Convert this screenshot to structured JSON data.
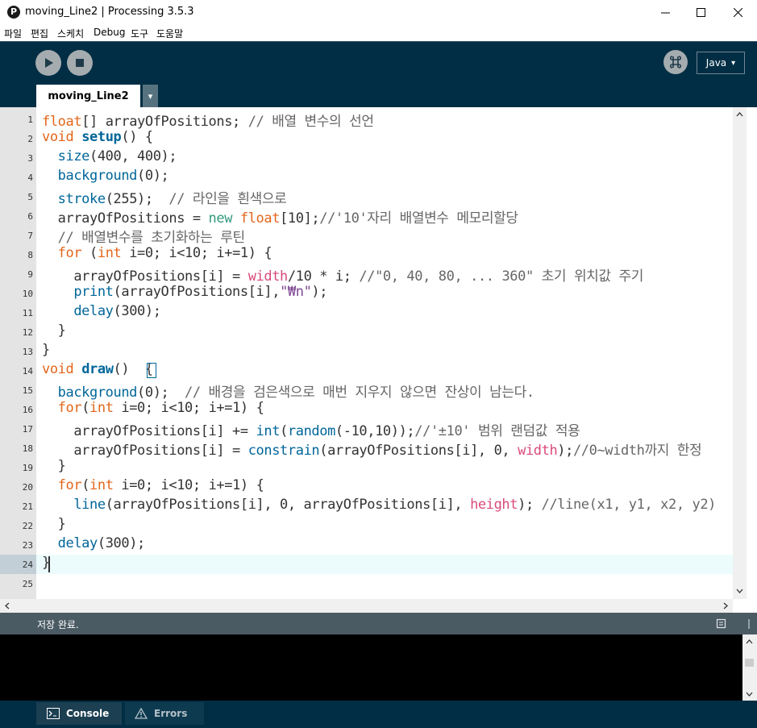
{
  "window": {
    "app_icon_text": "P",
    "title": "moving_Line2 | Processing 3.5.3",
    "minimize_icon": "minimize-icon",
    "maximize_icon": "maximize-icon",
    "close_icon": "close-icon"
  },
  "menubar": {
    "items": [
      "파일",
      "편집",
      "스케치",
      "Debug",
      "도구",
      "도움말"
    ]
  },
  "toolbar": {
    "run_icon": "play-icon",
    "stop_icon": "stop-icon",
    "debugger_icon": "debugger-icon",
    "mode": "Java",
    "mode_arrow": "▾"
  },
  "tab": {
    "label": "moving_Line2",
    "menu_arrow": "▾"
  },
  "editor": {
    "current_line": 24,
    "lines": [
      {
        "n": "1"
      },
      {
        "n": "2"
      },
      {
        "n": "3"
      },
      {
        "n": "4"
      },
      {
        "n": "5"
      },
      {
        "n": "6"
      },
      {
        "n": "7"
      },
      {
        "n": "8"
      },
      {
        "n": "9"
      },
      {
        "n": "10"
      },
      {
        "n": "11"
      },
      {
        "n": "12"
      },
      {
        "n": "13"
      },
      {
        "n": "14"
      },
      {
        "n": "15"
      },
      {
        "n": "16"
      },
      {
        "n": "17"
      },
      {
        "n": "18"
      },
      {
        "n": "19"
      },
      {
        "n": "20"
      },
      {
        "n": "21"
      },
      {
        "n": "22"
      },
      {
        "n": "23"
      },
      {
        "n": "24"
      },
      {
        "n": "25"
      }
    ],
    "code": [
      [
        [
          "kw",
          "float"
        ],
        [
          "",
          "[] arrayOfPositions; "
        ],
        [
          "cm",
          "// 배열 변수의 선언"
        ]
      ],
      [
        [
          "kw",
          "void "
        ],
        [
          "fnb",
          "setup"
        ],
        [
          "",
          "() {"
        ]
      ],
      [
        [
          "",
          "  "
        ],
        [
          "fn",
          "size"
        ],
        [
          "",
          "(400, 400);"
        ]
      ],
      [
        [
          "",
          "  "
        ],
        [
          "fn",
          "background"
        ],
        [
          "",
          "(0);"
        ]
      ],
      [
        [
          "",
          "  "
        ],
        [
          "fn",
          "stroke"
        ],
        [
          "",
          "(255);  "
        ],
        [
          "cm",
          "// 라인을 흰색으로"
        ]
      ],
      [
        [
          "",
          "  arrayOfPositions = "
        ],
        [
          "nw",
          "new "
        ],
        [
          "kw",
          "float"
        ],
        [
          "",
          "[10];"
        ],
        [
          "cm",
          "//'10'자리 배열변수 메모리할당"
        ]
      ],
      [
        [
          "",
          "  "
        ],
        [
          "cm",
          "// 배열변수를 초기화하는 루틴"
        ]
      ],
      [
        [
          "",
          "  "
        ],
        [
          "kw",
          "for "
        ],
        [
          "",
          "("
        ],
        [
          "kw",
          "int"
        ],
        [
          "",
          "",
          " i=0; i<10; i+=1) {"
        ]
      ],
      [
        [
          "",
          "    arrayOfPositions[i] = "
        ],
        [
          "api",
          "width"
        ],
        [
          "",
          "/10 * i; "
        ],
        [
          "cm",
          "//\"0, 40, 80, ... 360\" 초기 위치값 주기"
        ]
      ],
      [
        [
          "",
          "    "
        ],
        [
          "fn",
          "print"
        ],
        [
          "",
          "(arrayOfPositions[i],"
        ],
        [
          "str",
          "\"₩n\""
        ],
        [
          "",
          ");"
        ]
      ],
      [
        [
          "",
          "    "
        ],
        [
          "fn",
          "delay"
        ],
        [
          "",
          "(300);"
        ]
      ],
      [
        [
          "",
          "  }"
        ]
      ],
      [
        [
          "",
          "}"
        ]
      ],
      [
        [
          "kw",
          "void "
        ],
        [
          "fnb",
          "draw"
        ],
        [
          "",
          "()  {"
        ]
      ],
      [
        [
          "",
          "  "
        ],
        [
          "fn",
          "background"
        ],
        [
          "",
          "(0);  "
        ],
        [
          "cm",
          "// 배경을 검은색으로 매번 지우지 않으면 잔상이 남는다."
        ]
      ],
      [
        [
          "",
          "  "
        ],
        [
          "kw",
          "for"
        ],
        [
          "",
          "("
        ],
        [
          "kw",
          "int"
        ],
        [
          "",
          "",
          " i=0; i<10; i+=1) {"
        ]
      ],
      [
        [
          "",
          "    arrayOfPositions[i] += "
        ],
        [
          "fn",
          "int"
        ],
        [
          "",
          "("
        ],
        [
          "fn",
          "random"
        ],
        [
          "",
          "(-10,10));"
        ],
        [
          "cm",
          "//'±10' 범위 랜덤값 적용"
        ]
      ],
      [
        [
          "",
          "    arrayOfPositions[i] = "
        ],
        [
          "fn",
          "constrain"
        ],
        [
          "",
          "(arrayOfPositions[i], 0, "
        ],
        [
          "api",
          "width"
        ],
        [
          "",
          ");"
        ],
        [
          "cm",
          "//0~width까지 한정"
        ]
      ],
      [
        [
          "",
          "  }"
        ]
      ],
      [
        [
          "",
          "  "
        ],
        [
          "kw",
          "for"
        ],
        [
          "",
          "("
        ],
        [
          "kw",
          "int"
        ],
        [
          "",
          "",
          " i=0; i<10; i+=1) {"
        ]
      ],
      [
        [
          "",
          "    "
        ],
        [
          "fn",
          "line"
        ],
        [
          "",
          "(arrayOfPositions[i], 0, arrayOfPositions[i], "
        ],
        [
          "api",
          "height"
        ],
        [
          "",
          "); "
        ],
        [
          "cm",
          "//line(x1, y1, x2, y2)"
        ]
      ],
      [
        [
          "",
          "  }"
        ]
      ],
      [
        [
          "",
          "  "
        ],
        [
          "fn",
          "delay"
        ],
        [
          "",
          "(300);"
        ]
      ],
      [
        [
          "",
          "}"
        ]
      ],
      [
        [
          "",
          ""
        ]
      ]
    ]
  },
  "status": {
    "message": "저장 완료.",
    "notes_icon": "clipboard-icon"
  },
  "bottom_tabs": {
    "console": "Console",
    "errors": "Errors",
    "console_icon": "console-icon",
    "errors_icon": "warning-icon"
  },
  "colors": {
    "toolbar_bg": "#012e44",
    "keyword": "#e2661a",
    "function": "#006699",
    "builtin_var": "#d94a7a",
    "string": "#7d4793",
    "comment": "#666666",
    "new_keyword": "#33997e"
  }
}
